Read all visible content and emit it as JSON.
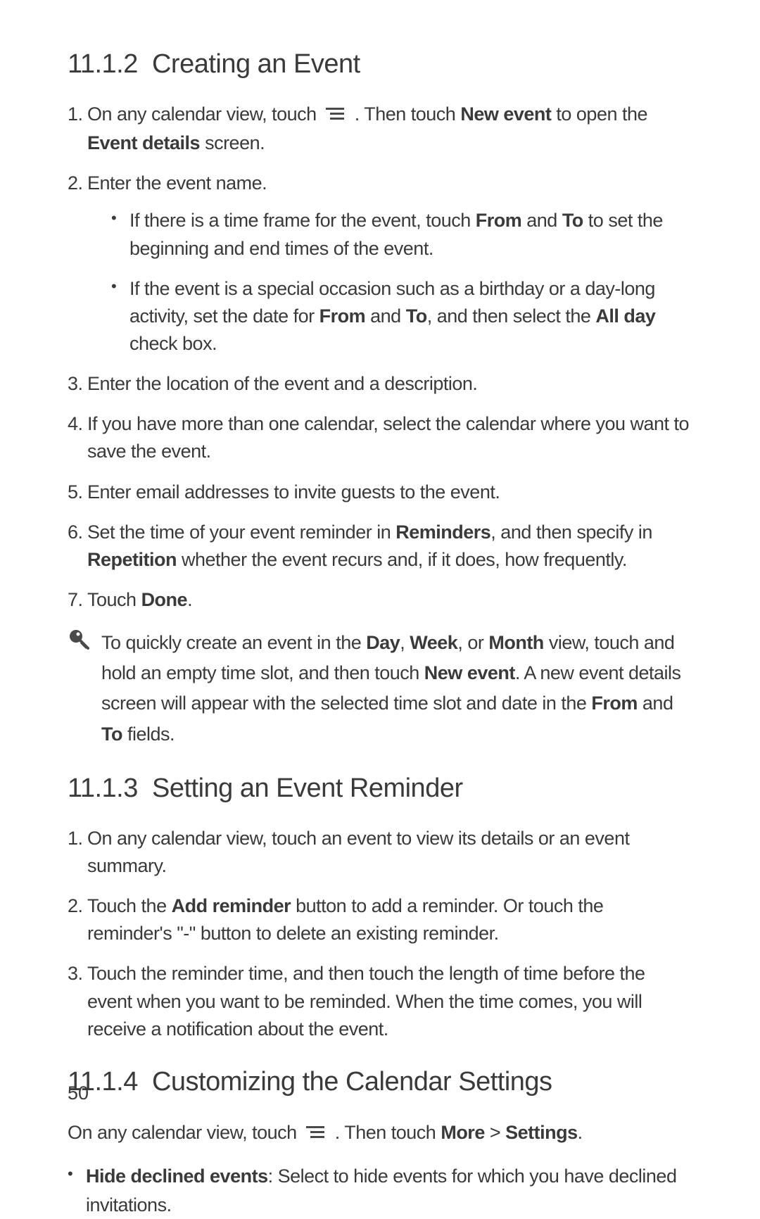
{
  "sections": {
    "s1": {
      "number": "11.1.2",
      "title": "Creating an Event",
      "step1_a": "On any calendar view, touch ",
      "step1_b": " . Then touch ",
      "step1_bold1": "New event",
      "step1_c": " to open the ",
      "step1_bold2": "Event details",
      "step1_d": " screen.",
      "step2": "Enter the event name.",
      "step2_sub1_a": "If there is a time frame for the event, touch ",
      "step2_sub1_b1": "From",
      "step2_sub1_b": " and ",
      "step2_sub1_b2": "To",
      "step2_sub1_c": " to set the beginning and end times of the event.",
      "step2_sub2_a": "If the event is a special occasion such as a birthday or a day-long activity, set the date for ",
      "step2_sub2_b1": "From",
      "step2_sub2_b": " and ",
      "step2_sub2_b2": "To",
      "step2_sub2_c": ", and then select the ",
      "step2_sub2_b3": "All day",
      "step2_sub2_d": " check box.",
      "step3": "Enter the location of the event and a description.",
      "step4": "If you have more than one calendar, select the calendar where you want to save the event.",
      "step5": "Enter email addresses to invite guests to the event.",
      "step6_a": "Set the time of your event reminder in ",
      "step6_b1": "Reminders",
      "step6_b": ", and then specify in ",
      "step6_b2": "Repetition",
      "step6_c": " whether the event recurs and, if it does, how frequently.",
      "step7_a": "Touch ",
      "step7_b1": "Done",
      "step7_b": "."
    },
    "tip": {
      "a": "To quickly create an event in the ",
      "b1": "Day",
      "b": ", ",
      "b2": "Week",
      "c": ", or ",
      "b3": "Month",
      "d": " view, touch and hold an empty time slot, and then touch ",
      "b4": "New event",
      "e": ". A new event details screen will appear with the selected time slot and date in the ",
      "b5": "From",
      "f": " and ",
      "b6": "To",
      "g": " fields."
    },
    "s2": {
      "number": "11.1.3",
      "title": "Setting an Event Reminder",
      "step1": "On any calendar view, touch an event to view its details or an event summary.",
      "step2_a": "Touch the ",
      "step2_b1": "Add reminder",
      "step2_b": " button to add a reminder. Or touch the reminder's \"-\" button to delete an existing reminder.",
      "step3": "Touch the reminder time, and then touch the length of time before the event when you want to be reminded. When the time comes, you will receive a notification about the event."
    },
    "s3": {
      "number": "11.1.4",
      "title": "Customizing the Calendar Settings",
      "lead_a": "On any calendar view, touch ",
      "lead_b": " . Then touch ",
      "lead_b1": "More",
      "lead_c": " > ",
      "lead_b2": "Settings",
      "lead_d": ".",
      "bullet1_b1": "Hide declined events",
      "bullet1_a": ": Select to hide events for which you have declined invitations."
    }
  },
  "page_number": "50"
}
